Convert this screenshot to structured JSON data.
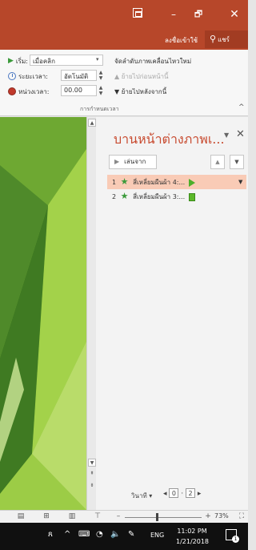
{
  "titlebar": {
    "signin_label": "ลงชื่อเข้าใช้",
    "share_label": "แชร์",
    "close_glyph": "✕",
    "minimize_glyph": "–",
    "maximize_glyph": "🗗"
  },
  "ribbon": {
    "start_label": "เริ่ม:",
    "start_value": "เมื่อคลิก",
    "duration_label": "ระยะเวลา:",
    "duration_value": "อัตโนมัติ",
    "delay_label": "หน่วงเวลา:",
    "delay_value": "00.00",
    "reorder_title": "จัดลำดับภาพเคลื่อนไหวใหม่",
    "move_earlier": "ย้ายไปก่อนหน้านี้",
    "move_later": "ย้ายไปหลังจากนี้",
    "group_label": "การกำหนดเวลา"
  },
  "pane": {
    "title": "บานหน้าต่างภาพเ...",
    "play_label": "เล่นจาก",
    "items": [
      {
        "number": "1",
        "label": "สี่เหลี่ยมผืนผ้า 4:..."
      },
      {
        "number": "2",
        "label": "สี่เหลี่ยมผืนผ้า 3:..."
      }
    ],
    "seconds_label": "วินาที",
    "pager_start": "0",
    "pager_end": "2"
  },
  "statusbar": {
    "zoom": "73%"
  },
  "taskbar": {
    "language": "ENG",
    "time": "11:02 PM",
    "date": "1/21/2018",
    "notification_count": "1"
  },
  "colors": {
    "accent": "#b7472a",
    "selection": "#f9cbb6",
    "pane_title": "#c84b30",
    "slide_green": "#7dba2a"
  }
}
